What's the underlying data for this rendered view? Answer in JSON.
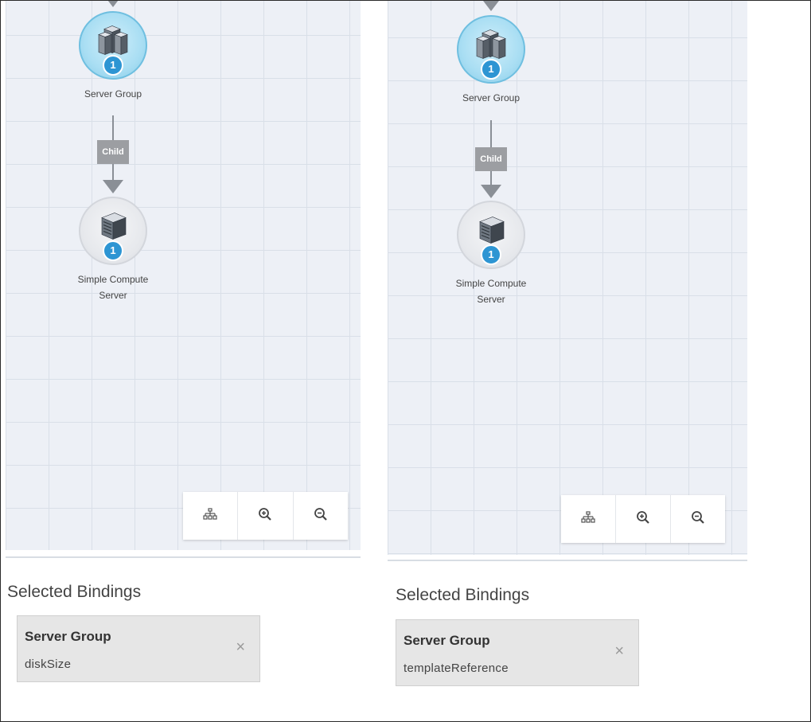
{
  "panels": [
    {
      "nodes": {
        "group_label": "Server Group",
        "group_count": "1",
        "server_label_line1": "Simple Compute",
        "server_label_line2": "Server",
        "server_count": "1"
      },
      "edge_label": "Child",
      "toolbar": {
        "layout": "hierarchy-icon",
        "zoom_in": "zoom-in-icon",
        "zoom_out": "zoom-out-icon"
      },
      "bindings_title": "Selected Bindings",
      "binding": {
        "title": "Server Group",
        "value": "diskSize",
        "close": "×"
      }
    },
    {
      "nodes": {
        "group_label": "Server Group",
        "group_count": "1",
        "server_label_line1": "Simple Compute",
        "server_label_line2": "Server",
        "server_count": "1"
      },
      "edge_label": "Child",
      "toolbar": {
        "layout": "hierarchy-icon",
        "zoom_in": "zoom-in-icon",
        "zoom_out": "zoom-out-icon"
      },
      "bindings_title": "Selected Bindings",
      "binding": {
        "title": "Server Group",
        "value": "templateReference",
        "close": "×"
      }
    }
  ],
  "colors": {
    "canvas_bg": "#edf0f6",
    "badge": "#2d95d3",
    "group_circle": "#a9def3",
    "edge": "#8a8f96",
    "card_bg": "#e6e6e6"
  }
}
